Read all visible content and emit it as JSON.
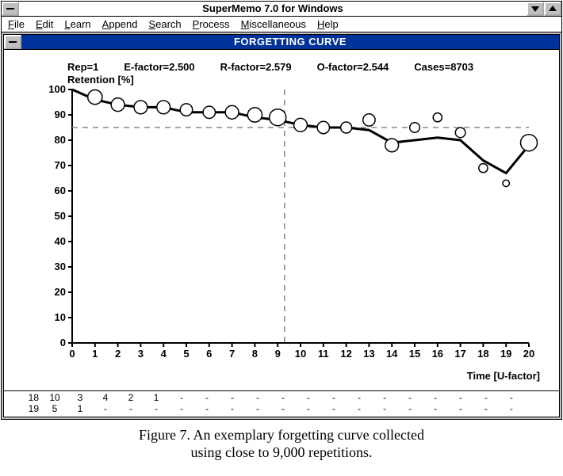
{
  "window": {
    "title": "SuperMemo 7.0 for Windows"
  },
  "menu": {
    "file": "File",
    "edit": "Edit",
    "learn": "Learn",
    "append": "Append",
    "search": "Search",
    "process": "Process",
    "misc": "Miscellaneous",
    "help": "Help"
  },
  "subwindow": {
    "title": "FORGETTING CURVE"
  },
  "stats": {
    "rep": "Rep=1",
    "efactor": "E-factor=2.500",
    "rfactor": "R-factor=2.579",
    "ofactor": "O-factor=2.544",
    "cases": "Cases=8703"
  },
  "axes": {
    "ylabel": "Retention [%]",
    "xlabel": "Time [U-factor]"
  },
  "bottom": {
    "row18": {
      "lead": "18",
      "cells": [
        "10",
        "3",
        "4",
        "2",
        "1",
        "-",
        "-",
        "-",
        "-",
        "-",
        "-",
        "-",
        "-",
        "-",
        "-",
        "-",
        "-",
        "-",
        "-"
      ]
    },
    "row19": {
      "lead": "19",
      "cells": [
        "5",
        "1",
        "-",
        "-",
        "-",
        "-",
        "-",
        "-",
        "-",
        "-",
        "-",
        "-",
        "-",
        "-",
        "-",
        "-",
        "-",
        "-",
        "-"
      ]
    }
  },
  "caption": {
    "line1": "Figure 7. An exemplary forgetting curve collected",
    "line2": "using close to 9,000 repetitions."
  },
  "chart_data": {
    "type": "scatter+line",
    "title": "Forgetting Curve (Rep=1, E-factor=2.500, R-factor=2.579, O-factor=2.544, Cases=8703)",
    "xlabel": "Time [U-factor]",
    "ylabel": "Retention [%]",
    "xlim": [
      0,
      20
    ],
    "ylim": [
      0,
      100
    ],
    "xticks": [
      0,
      1,
      2,
      3,
      4,
      5,
      6,
      7,
      8,
      9,
      10,
      11,
      12,
      13,
      14,
      15,
      16,
      17,
      18,
      19,
      20
    ],
    "yticks": [
      0,
      10,
      20,
      30,
      40,
      50,
      60,
      70,
      80,
      90,
      100
    ],
    "reference": {
      "y": 85,
      "x": 9.3
    },
    "series": [
      {
        "name": "Retention data points",
        "style": "open-circles",
        "points": [
          {
            "x": 1,
            "y": 97,
            "size": 1.3
          },
          {
            "x": 2,
            "y": 94,
            "size": 1.2
          },
          {
            "x": 3,
            "y": 93,
            "size": 1.2
          },
          {
            "x": 4,
            "y": 93,
            "size": 1.2
          },
          {
            "x": 5,
            "y": 92,
            "size": 1.1
          },
          {
            "x": 6,
            "y": 91,
            "size": 1.1
          },
          {
            "x": 7,
            "y": 91,
            "size": 1.2
          },
          {
            "x": 8,
            "y": 90,
            "size": 1.3
          },
          {
            "x": 9,
            "y": 89,
            "size": 1.5
          },
          {
            "x": 10,
            "y": 86,
            "size": 1.2
          },
          {
            "x": 11,
            "y": 85,
            "size": 1.1
          },
          {
            "x": 12,
            "y": 85,
            "size": 1.0
          },
          {
            "x": 13,
            "y": 88,
            "size": 1.1
          },
          {
            "x": 14,
            "y": 78,
            "size": 1.2
          },
          {
            "x": 15,
            "y": 85,
            "size": 0.9
          },
          {
            "x": 16,
            "y": 89,
            "size": 0.8
          },
          {
            "x": 17,
            "y": 83,
            "size": 0.9
          },
          {
            "x": 18,
            "y": 69,
            "size": 0.8
          },
          {
            "x": 19,
            "y": 63,
            "size": 0.6
          },
          {
            "x": 20,
            "y": 79,
            "size": 1.5
          }
        ]
      },
      {
        "name": "Fitted forgetting curve",
        "style": "line",
        "points": [
          {
            "x": 0,
            "y": 100
          },
          {
            "x": 1,
            "y": 96
          },
          {
            "x": 2,
            "y": 94
          },
          {
            "x": 3,
            "y": 93
          },
          {
            "x": 4,
            "y": 93
          },
          {
            "x": 5,
            "y": 91
          },
          {
            "x": 6,
            "y": 91
          },
          {
            "x": 7,
            "y": 91
          },
          {
            "x": 8,
            "y": 89
          },
          {
            "x": 9,
            "y": 88
          },
          {
            "x": 10,
            "y": 86
          },
          {
            "x": 11,
            "y": 85
          },
          {
            "x": 12,
            "y": 85
          },
          {
            "x": 13,
            "y": 84
          },
          {
            "x": 14,
            "y": 79
          },
          {
            "x": 15,
            "y": 80
          },
          {
            "x": 16,
            "y": 81
          },
          {
            "x": 17,
            "y": 80
          },
          {
            "x": 18,
            "y": 72
          },
          {
            "x": 19,
            "y": 67
          },
          {
            "x": 20,
            "y": 78
          }
        ]
      }
    ]
  }
}
